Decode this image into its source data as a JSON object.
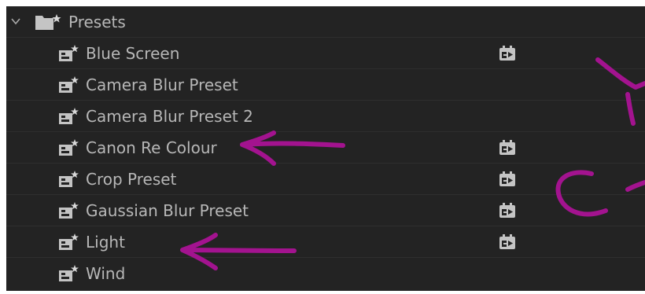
{
  "panel": {
    "folder": {
      "label": "Presets",
      "expanded": true,
      "chevron_icon": "chevron-down-icon",
      "icon": "folder-star-icon"
    },
    "items": [
      {
        "label": "Blue Screen",
        "icon": "preset-bin-icon",
        "accelerated": true
      },
      {
        "label": "Camera Blur Preset",
        "icon": "preset-bin-icon",
        "accelerated": false
      },
      {
        "label": "Camera Blur Preset 2",
        "icon": "preset-bin-icon",
        "accelerated": false
      },
      {
        "label": "Canon Re Colour",
        "icon": "preset-bin-icon",
        "accelerated": true
      },
      {
        "label": "Crop Preset",
        "icon": "preset-bin-icon",
        "accelerated": true
      },
      {
        "label": "Gaussian Blur Preset",
        "icon": "preset-bin-icon",
        "accelerated": true
      },
      {
        "label": "Light",
        "icon": "preset-bin-icon",
        "accelerated": true
      },
      {
        "label": "Wind",
        "icon": "preset-bin-icon",
        "accelerated": false
      }
    ],
    "accelerated_icon": "gpu-accelerated-icon"
  },
  "colors": {
    "panel_bg": "#232323",
    "text": "#b7b7b7",
    "icon": "#c4c4c4",
    "annotation": "#a3138f"
  },
  "annotations": [
    "arrow-canon-re-colour",
    "arrow-light",
    "partial-letter-a",
    "partial-letter-c"
  ]
}
